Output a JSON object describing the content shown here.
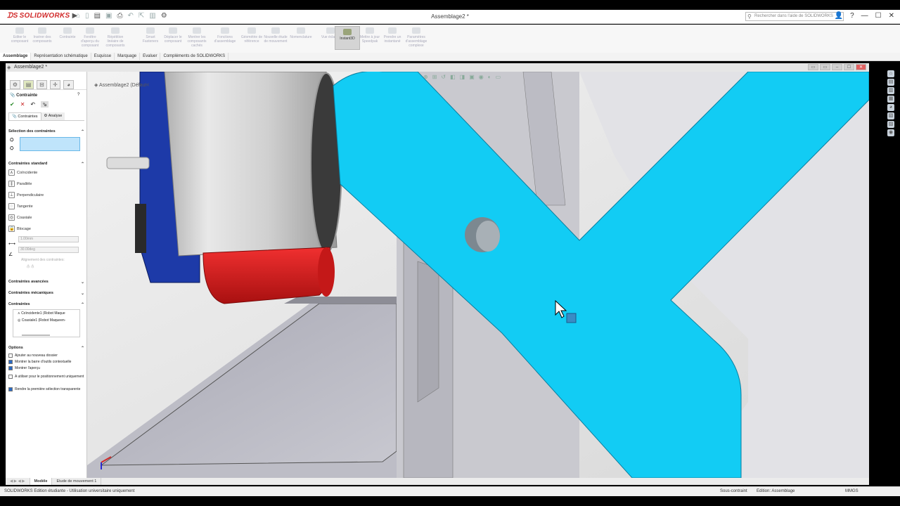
{
  "app": {
    "logo_text": "SOLIDWORKS",
    "document_title": "Assemblage2 *",
    "search_placeholder": "Rechercher dans l'aide de SOLIDWORKS",
    "help_label": "?"
  },
  "commands": [
    "Editer le composant",
    "Insérer des composants",
    "Contrainte",
    "Fenêtre d'aperçu du composant",
    "Répétition linéaire de composants",
    "Smart Fasteners",
    "Déplacer le composant",
    "Montrer les composants cachés",
    "Fonctions d'assemblage",
    "Géométrie de référence",
    "Nouvelle étude de mouvement",
    "Nomenclature",
    "Vue éclatée",
    "Instant3D",
    "Mettre à jour Speedpak",
    "Prendre un instantané",
    "Paramètres d'assemblage complexe"
  ],
  "active_command": "Instant3D",
  "tabs": [
    "Assemblage",
    "Représentation schématique",
    "Esquisse",
    "Marquage",
    "Evaluer",
    "Compléments de SOLIDWORKS"
  ],
  "doc_window": {
    "title": "Assemblage2 *"
  },
  "pm": {
    "title": "Contrainte",
    "subtabs": [
      "Contraintes",
      "Analyse"
    ],
    "sections": {
      "selection": "Sélection des contraintes",
      "standard": "Contraintes standard",
      "advanced": "Contraintes avancées",
      "mechanical": "Contraintes mécaniques",
      "mates": "Contraintes",
      "options": "Options"
    },
    "standard_mates": [
      "Coïncidente",
      "Parallèle",
      "Perpendiculaire",
      "Tangente",
      "Coaxiale",
      "Blocage"
    ],
    "distance_value": "1.00mm",
    "angle_value": "30.00deg",
    "alignment_label": "Alignement des contraintes:",
    "mate_list": [
      "Coïncidente1 (Robot Maque",
      "Coaxiale1 (Robot Maqueen-"
    ],
    "options": [
      {
        "label": "Ajouter au nouveau dossier",
        "checked": false
      },
      {
        "label": "Montrer la barre d'outils contextuelle",
        "checked": true
      },
      {
        "label": "Montrer l'aperçu",
        "checked": true
      },
      {
        "label": "A utiliser pour le positionnement uniquement",
        "checked": false
      },
      {
        "label": "Rendre la première sélection transparente",
        "checked": true
      }
    ]
  },
  "viewport": {
    "tree_label": "Assemblage2",
    "tree_config": "(Défaut<",
    "part_color": "#12ccf4",
    "red_color": "#d81e1e",
    "blue_color": "#1d3aa8"
  },
  "bottom_tabs": [
    "Modèle",
    "Etude de mouvement 1"
  ],
  "status": {
    "left": "SOLIDWORKS Edition étudiante - Utilisation universitaire uniquement",
    "constraint": "Sous-contraint",
    "editing": "Edition: Assemblage",
    "units": "MMGS"
  }
}
